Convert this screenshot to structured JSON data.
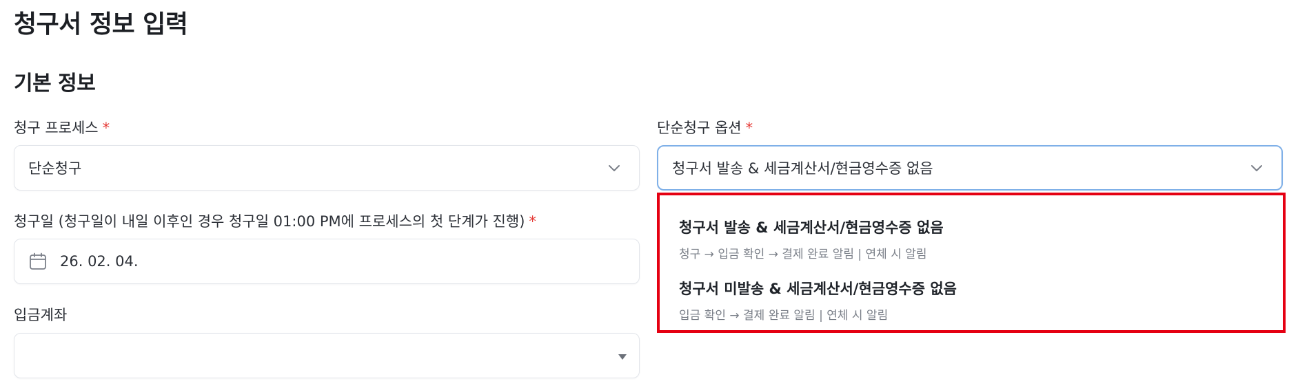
{
  "page": {
    "title": "청구서 정보 입력"
  },
  "section": {
    "title": "기본 정보"
  },
  "fields": {
    "process": {
      "label": "청구 프로세스",
      "required_mark": "*",
      "value": "단순청구"
    },
    "simple_option": {
      "label": "단순청구 옵션",
      "required_mark": "*",
      "value": "청구서 발송 & 세금계산서/현금영수증 없음"
    },
    "billing_date": {
      "label": "청구일 (청구일이 내일 이후인 경우 청구일 01:00 PM에 프로세스의 첫 단계가 진행)",
      "required_mark": "*",
      "value": "26. 02. 04."
    },
    "deposit_account": {
      "label": "입금계좌",
      "value": ""
    }
  },
  "dropdown": {
    "options": [
      {
        "title": "청구서 발송 & 세금계산서/현금영수증 없음",
        "desc": "청구 → 입금 확인 → 결제 완료 알림  |  연체 시 알림"
      },
      {
        "title": "청구서 미발송 & 세금계산서/현금영수증 없음",
        "desc": "입금 확인 → 결제 완료 알림  |  연체 시 알림"
      }
    ]
  },
  "colors": {
    "required": "#e53935",
    "focus_border": "#7fb0e8",
    "highlight": "#e50012"
  },
  "icons": {
    "select": "chevron-down-icon",
    "date": "calendar-icon",
    "native_select": "caret-down-icon"
  }
}
